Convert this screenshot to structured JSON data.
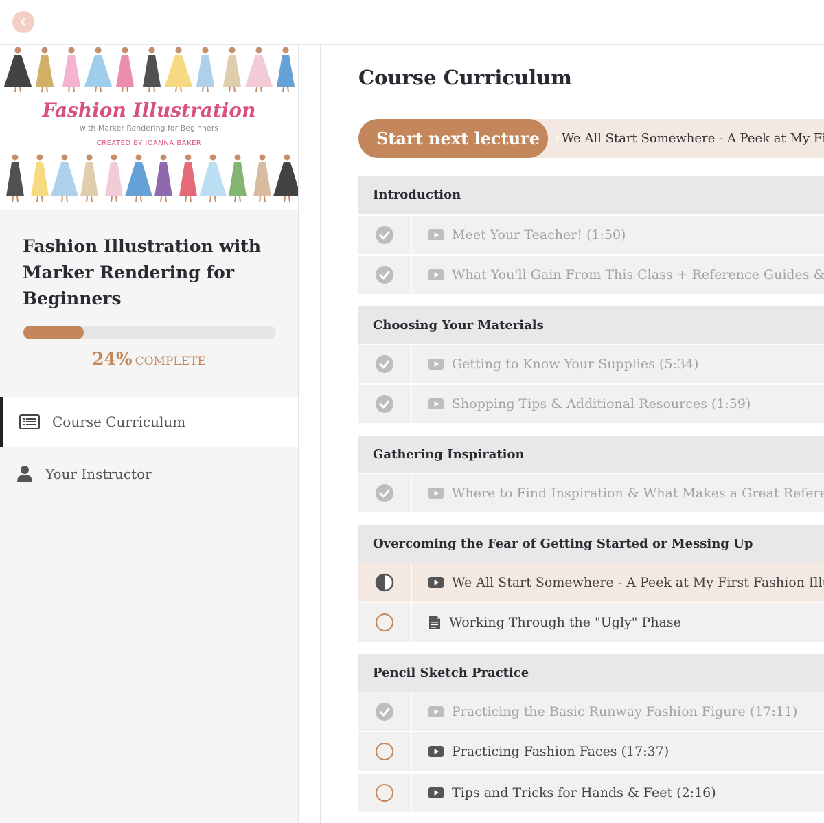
{
  "colors": {
    "accent": "#c4875c",
    "back_button": "#f3cfc4",
    "current_row": "#f3e8e2",
    "section_bg": "#e8e8e8",
    "row_bg": "#f1f1f1"
  },
  "header": {
    "back_icon": "chevron-left-icon"
  },
  "sidebar": {
    "cover": {
      "title": "Fashion Illustration",
      "subtitle": "with Marker Rendering for Beginners",
      "credit": "CREATED BY JOANNA BAKER"
    },
    "course_title": "Fashion Illustration with Marker Rendering for Beginners",
    "progress": {
      "percent": 24,
      "percent_label": "24%",
      "label": "COMPLETE"
    },
    "nav": [
      {
        "label": "Course Curriculum",
        "icon": "list-icon",
        "active": true
      },
      {
        "label": "Your Instructor",
        "icon": "user-icon",
        "active": false
      }
    ]
  },
  "main": {
    "title": "Course Curriculum",
    "start_button": "Start next lecture",
    "next_lecture": "We All Start Somewhere - A Peek at My First Fashion Illustrations",
    "sections": [
      {
        "title": "Introduction",
        "lectures": [
          {
            "title": "Meet Your Teacher! (1:50)",
            "status": "complete",
            "type": "video"
          },
          {
            "title": "What You'll Gain From This Class + Reference Guides & Worksheets",
            "status": "complete",
            "type": "video"
          }
        ]
      },
      {
        "title": "Choosing Your Materials",
        "lectures": [
          {
            "title": "Getting to Know Your Supplies (5:34)",
            "status": "complete",
            "type": "video"
          },
          {
            "title": "Shopping Tips & Additional Resources (1:59)",
            "status": "complete",
            "type": "video"
          }
        ]
      },
      {
        "title": "Gathering Inspiration",
        "lectures": [
          {
            "title": "Where to Find Inspiration & What Makes a Great Reference Image",
            "status": "complete",
            "type": "video"
          }
        ]
      },
      {
        "title": "Overcoming the Fear of Getting Started or Messing Up",
        "lectures": [
          {
            "title": "We All Start Somewhere - A Peek at My First Fashion Illustrations",
            "status": "in-progress",
            "type": "video"
          },
          {
            "title": "Working Through the \"Ugly\" Phase",
            "status": "incomplete",
            "type": "text"
          }
        ]
      },
      {
        "title": "Pencil Sketch Practice",
        "lectures": [
          {
            "title": "Practicing the Basic Runway Fashion Figure (17:11)",
            "status": "complete",
            "type": "video"
          },
          {
            "title": "Practicing Fashion Faces (17:37)",
            "status": "incomplete",
            "type": "video"
          },
          {
            "title": "Tips and Tricks for Hands & Feet (2:16)",
            "status": "incomplete",
            "type": "video"
          }
        ]
      }
    ]
  }
}
